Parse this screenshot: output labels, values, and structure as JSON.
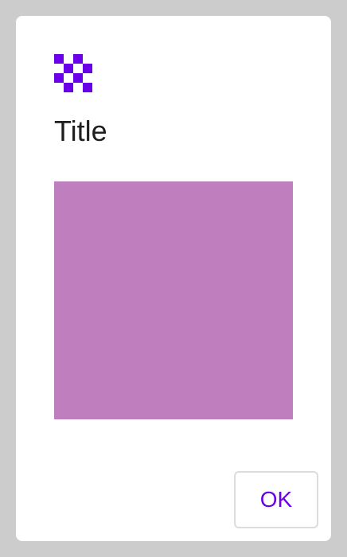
{
  "dialog": {
    "icon": "checkerboard-icon",
    "title": "Title",
    "content": {
      "image_color": "#bf7fbf"
    },
    "actions": {
      "ok_label": "OK"
    }
  },
  "colors": {
    "backdrop": "#cccccc",
    "surface": "#ffffff",
    "accent": "#6a00e8",
    "title_text": "#1f1f1f",
    "button_border": "#dcdcdc"
  }
}
